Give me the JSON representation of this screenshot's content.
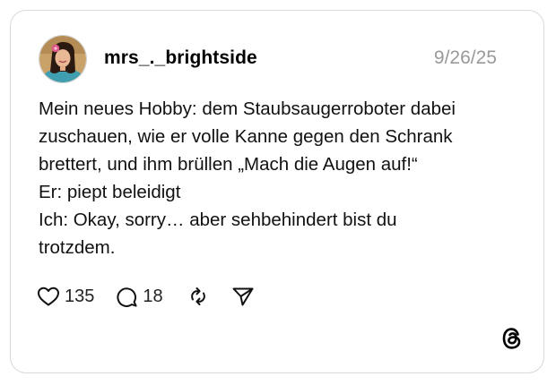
{
  "post": {
    "username": "mrs_._brightside",
    "date": "9/26/25",
    "text_lines": [
      "Mein neues Hobby: dem Staubsaugerroboter dabei",
      "zuschauen, wie er volle Kanne gegen den Schrank",
      "brettert, und ihm brüllen „Mach die Augen auf!“",
      "Er: piept beleidigt",
      "Ich: Okay, sorry… aber sehbehindert bist du",
      "trotzdem."
    ],
    "actions": {
      "likes": "135",
      "replies": "18"
    }
  },
  "icons": {
    "like": "heart-outline-icon",
    "reply": "speech-bubble-icon",
    "repost": "repost-arrows-icon",
    "share": "paper-plane-icon",
    "brand": "threads-logo-icon"
  },
  "colors": {
    "card_border": "#d9d9d9",
    "date_text": "#999999",
    "text": "#111111"
  }
}
